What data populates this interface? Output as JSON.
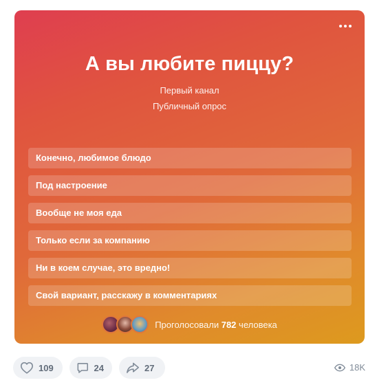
{
  "poll": {
    "title": "А вы любите пиццу?",
    "author": "Первый канал",
    "type": "Публичный опрос",
    "options": [
      "Конечно, любимое блюдо",
      "Под настроение",
      "Вообще не моя еда",
      "Только если за компанию",
      "Ни в коем случае, это вредно!",
      "Свой вариант, расскажу в комментариях"
    ],
    "voters_prefix": "Проголосовали",
    "voters_count": "782",
    "voters_suffix": "человека",
    "gradient_colors": [
      "#df3e50",
      "#e0693a",
      "#dd9a1e"
    ]
  },
  "actions": {
    "likes": "109",
    "comments": "24",
    "shares": "27",
    "views": "18K"
  },
  "icons": {
    "menu": "more-horizontal-icon",
    "like": "heart-icon",
    "comment": "comment-icon",
    "share": "share-arrow-icon",
    "views": "eye-icon"
  }
}
